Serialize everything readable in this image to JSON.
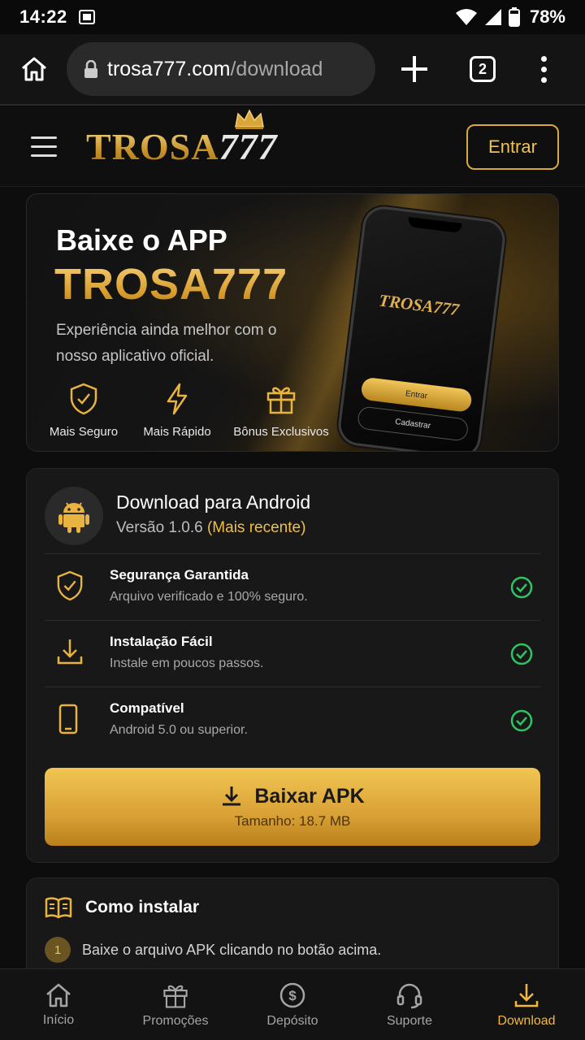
{
  "status_bar": {
    "time": "14:22",
    "battery": "78%"
  },
  "browser": {
    "url_host": "trosa777.com",
    "url_path": "/download",
    "tab_count": "2"
  },
  "header": {
    "logo_main": "TROSA",
    "logo_num": "777",
    "login_label": "Entrar"
  },
  "hero": {
    "heading": "Baixe o APP",
    "brand": "TROSA777",
    "description": "Experiência ainda melhor com o nosso aplicativo oficial.",
    "features": [
      {
        "icon": "shield-check-icon",
        "label": "Mais Seguro"
      },
      {
        "icon": "lightning-icon",
        "label": "Mais Rápido"
      },
      {
        "icon": "gift-icon",
        "label": "Bônus Exclusivos"
      }
    ],
    "phone": {
      "title_main": "TROSA",
      "title_num": "777",
      "btn_primary": "Entrar",
      "btn_secondary": "Cadastrar"
    }
  },
  "download": {
    "title": "Download para Android",
    "version_prefix": "Versão 1.0.6",
    "version_tag": "(Mais recente)",
    "features": [
      {
        "icon": "shield-check-icon",
        "title": "Segurança Garantida",
        "desc": "Arquivo verificado e 100% seguro."
      },
      {
        "icon": "download-tray-icon",
        "title": "Instalação Fácil",
        "desc": "Instale em poucos passos."
      },
      {
        "icon": "smartphone-icon",
        "title": "Compatível",
        "desc": "Android 5.0 ou superior."
      }
    ],
    "button_label": "Baixar APK",
    "button_size": "Tamanho: 18.7 MB"
  },
  "install": {
    "title": "Como instalar",
    "steps": [
      {
        "num": "1",
        "text": "Baixe o arquivo APK clicando no botão acima."
      }
    ]
  },
  "bottom_nav": [
    {
      "icon": "home-icon",
      "label": "Início",
      "active": false
    },
    {
      "icon": "gift-icon",
      "label": "Promoções",
      "active": false
    },
    {
      "icon": "dollar-circle-icon",
      "label": "Depósito",
      "active": false
    },
    {
      "icon": "headset-icon",
      "label": "Suporte",
      "active": false
    },
    {
      "icon": "download-icon",
      "label": "Download",
      "active": true
    }
  ],
  "colors": {
    "accent": "#f2b93b",
    "gold_dark": "#b9801c",
    "check_green": "#2fc463",
    "background": "#0d0d0d",
    "card": "#181818"
  }
}
